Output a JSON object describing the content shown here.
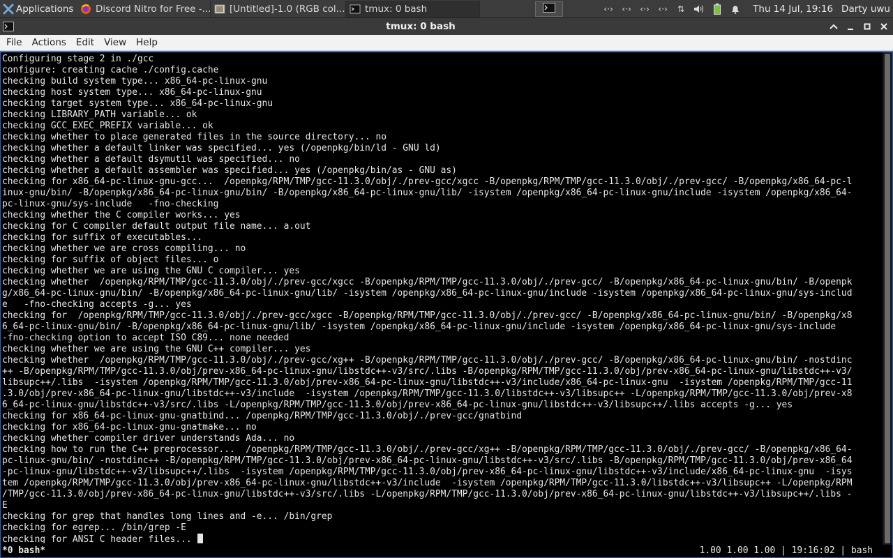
{
  "panel": {
    "applications_label": "Applications",
    "tasks": [
      {
        "label": "Discord Nitro for Free -...",
        "icon": "firefox-icon"
      },
      {
        "label": "[Untitled]-1.0 (RGB col...",
        "icon": "gimp-icon"
      },
      {
        "label": "tmux: 0 bash",
        "icon": "terminal-icon"
      }
    ],
    "clock": "Thu 14 Jul, 19:16",
    "user": "Darty uwu"
  },
  "window": {
    "title": "tmux: 0 bash"
  },
  "menu": {
    "items": [
      "File",
      "Actions",
      "Edit",
      "View",
      "Help"
    ]
  },
  "terminal": {
    "lines": [
      "Configuring stage 2 in ./gcc",
      "configure: creating cache ./config.cache",
      "checking build system type... x86_64-pc-linux-gnu",
      "checking host system type... x86_64-pc-linux-gnu",
      "checking target system type... x86_64-pc-linux-gnu",
      "checking LIBRARY_PATH variable... ok",
      "checking GCC_EXEC_PREFIX variable... ok",
      "checking whether to place generated files in the source directory... no",
      "checking whether a default linker was specified... yes (/openpkg/bin/ld - GNU ld)",
      "checking whether a default dsymutil was specified... no",
      "checking whether a default assembler was specified... yes (/openpkg/bin/as - GNU as)",
      "checking for x86_64-pc-linux-gnu-gcc...  /openpkg/RPM/TMP/gcc-11.3.0/obj/./prev-gcc/xgcc -B/openpkg/RPM/TMP/gcc-11.3.0/obj/./prev-gcc/ -B/openpkg/x86_64-pc-l",
      "inux-gnu/bin/ -B/openpkg/x86_64-pc-linux-gnu/bin/ -B/openpkg/x86_64-pc-linux-gnu/lib/ -isystem /openpkg/x86_64-pc-linux-gnu/include -isystem /openpkg/x86_64-",
      "pc-linux-gnu/sys-include   -fno-checking",
      "checking whether the C compiler works... yes",
      "checking for C compiler default output file name... a.out",
      "checking for suffix of executables...",
      "checking whether we are cross compiling... no",
      "checking for suffix of object files... o",
      "checking whether we are using the GNU C compiler... yes",
      "checking whether  /openpkg/RPM/TMP/gcc-11.3.0/obj/./prev-gcc/xgcc -B/openpkg/RPM/TMP/gcc-11.3.0/obj/./prev-gcc/ -B/openpkg/x86_64-pc-linux-gnu/bin/ -B/openpk",
      "g/x86_64-pc-linux-gnu/bin/ -B/openpkg/x86_64-pc-linux-gnu/lib/ -isystem /openpkg/x86_64-pc-linux-gnu/include -isystem /openpkg/x86_64-pc-linux-gnu/sys-includ",
      "e   -fno-checking accepts -g... yes",
      "checking for  /openpkg/RPM/TMP/gcc-11.3.0/obj/./prev-gcc/xgcc -B/openpkg/RPM/TMP/gcc-11.3.0/obj/./prev-gcc/ -B/openpkg/x86_64-pc-linux-gnu/bin/ -B/openpkg/x8",
      "6_64-pc-linux-gnu/bin/ -B/openpkg/x86_64-pc-linux-gnu/lib/ -isystem /openpkg/x86_64-pc-linux-gnu/include -isystem /openpkg/x86_64-pc-linux-gnu/sys-include",
      "-fno-checking option to accept ISO C89... none needed",
      "checking whether we are using the GNU C++ compiler... yes",
      "checking whether  /openpkg/RPM/TMP/gcc-11.3.0/obj/./prev-gcc/xg++ -B/openpkg/RPM/TMP/gcc-11.3.0/obj/./prev-gcc/ -B/openpkg/x86_64-pc-linux-gnu/bin/ -nostdinc",
      "++ -B/openpkg/RPM/TMP/gcc-11.3.0/obj/prev-x86_64-pc-linux-gnu/libstdc++-v3/src/.libs -B/openpkg/RPM/TMP/gcc-11.3.0/obj/prev-x86_64-pc-linux-gnu/libstdc++-v3/",
      "libsupc++/.libs  -isystem /openpkg/RPM/TMP/gcc-11.3.0/obj/prev-x86_64-pc-linux-gnu/libstdc++-v3/include/x86_64-pc-linux-gnu  -isystem /openpkg/RPM/TMP/gcc-11",
      ".3.0/obj/prev-x86_64-pc-linux-gnu/libstdc++-v3/include  -isystem /openpkg/RPM/TMP/gcc-11.3.0/libstdc++-v3/libsupc++ -L/openpkg/RPM/TMP/gcc-11.3.0/obj/prev-x8",
      "6_64-pc-linux-gnu/libstdc++-v3/src/.libs -L/openpkg/RPM/TMP/gcc-11.3.0/obj/prev-x86_64-pc-linux-gnu/libstdc++-v3/libsupc++/.libs accepts -g... yes",
      "checking for x86_64-pc-linux-gnu-gnatbind... /openpkg/RPM/TMP/gcc-11.3.0/obj/./prev-gcc/gnatbind",
      "checking for x86_64-pc-linux-gnu-gnatmake... no",
      "checking whether compiler driver understands Ada... no",
      "checking how to run the C++ preprocessor...  /openpkg/RPM/TMP/gcc-11.3.0/obj/./prev-gcc/xg++ -B/openpkg/RPM/TMP/gcc-11.3.0/obj/./prev-gcc/ -B/openpkg/x86_64-",
      "pc-linux-gnu/bin/ -nostdinc++ -B/openpkg/RPM/TMP/gcc-11.3.0/obj/prev-x86_64-pc-linux-gnu/libstdc++-v3/src/.libs -B/openpkg/RPM/TMP/gcc-11.3.0/obj/prev-x86_64",
      "-pc-linux-gnu/libstdc++-v3/libsupc++/.libs  -isystem /openpkg/RPM/TMP/gcc-11.3.0/obj/prev-x86_64-pc-linux-gnu/libstdc++-v3/include/x86_64-pc-linux-gnu  -isys",
      "tem /openpkg/RPM/TMP/gcc-11.3.0/obj/prev-x86_64-pc-linux-gnu/libstdc++-v3/include  -isystem /openpkg/RPM/TMP/gcc-11.3.0/libstdc++-v3/libsupc++ -L/openpkg/RPM",
      "/TMP/gcc-11.3.0/obj/prev-x86_64-pc-linux-gnu/libstdc++-v3/src/.libs -L/openpkg/RPM/TMP/gcc-11.3.0/obj/prev-x86_64-pc-linux-gnu/libstdc++-v3/libsupc++/.libs -",
      "E",
      "checking for grep that handles long lines and -e... /bin/grep",
      "checking for egrep... /bin/grep -E"
    ],
    "prompt_line": "checking for ANSI C header files... "
  },
  "tmux": {
    "window_label": "*0 bash*",
    "right": "1.00 1.00 1.00 | 19:16:02 | bash"
  },
  "colors": {
    "terminal_bg": "#000000",
    "terminal_fg": "#e6e6e6",
    "panel_bg": "#3c3c3c",
    "menubar_bg": "#f2f2f2"
  }
}
